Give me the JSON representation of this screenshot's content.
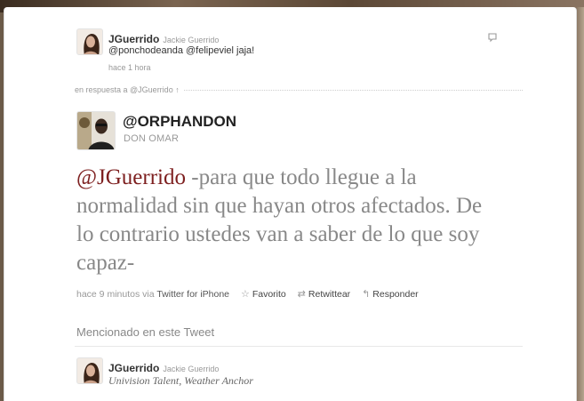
{
  "top_tweet": {
    "name": "JGuerrido",
    "full_name": "Jackie Guerrido",
    "text": "@ponchodeanda @felipeviel jaja!",
    "time": "hace 1 hora"
  },
  "in_reply_to": "en respuesta a @JGuerrido ↑",
  "main_tweet": {
    "handle": "@ORPHANDON",
    "full_name": "DON OMAR",
    "mention": "@JGuerrido",
    "text": " -para que todo llegue a la normalidad sin que hayan otros afectados. De lo contrario ustedes van a saber de lo que soy capaz-",
    "time": "hace 9 minutos",
    "via_label": "via",
    "via_app": "Twitter for iPhone",
    "favorite_label": "Favorito",
    "retweet_label": "Retwittear",
    "reply_label": "Responder"
  },
  "mentioned": {
    "title": "Mencionado en este Tweet",
    "name": "JGuerrido",
    "full_name": "Jackie Guerrido",
    "bio": "Univision Talent, Weather Anchor"
  },
  "icons": {
    "reply": "speech-bubble-icon",
    "favorite": "star-icon",
    "retweet": "retweet-icon",
    "respond": "reply-arrow-icon"
  }
}
